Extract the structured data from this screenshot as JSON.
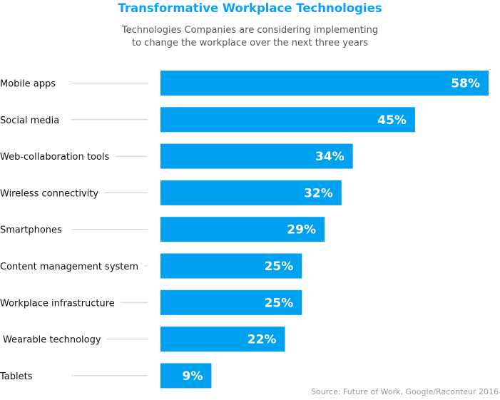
{
  "chart_data": {
    "type": "bar",
    "orientation": "horizontal",
    "title": "Transformative Workplace Technologies",
    "subtitle": [
      "Technologies Companies are considering implementing",
      "to change the workplace over the next three years"
    ],
    "categories": [
      "Mobile apps",
      "Social media",
      "Web-collaboration tools",
      "Wireless connectivity",
      "Smartphones",
      "Content management system",
      "Workplace infrastructure",
      "Wearable technology",
      "Tablets"
    ],
    "values": [
      58,
      45,
      34,
      32,
      29,
      25,
      25,
      22,
      9
    ],
    "labels": [
      "58%",
      "45%",
      "34%",
      "32%",
      "29%",
      "25%",
      "25%",
      "22%",
      "9%"
    ],
    "unit": "%",
    "xlabel": "",
    "ylabel": "",
    "xlim": [
      0,
      58
    ],
    "grid": false,
    "legend": "none",
    "bar_color": "#00a1f1",
    "source": "Source: Future of Work, Google/Raconteur 2016"
  }
}
